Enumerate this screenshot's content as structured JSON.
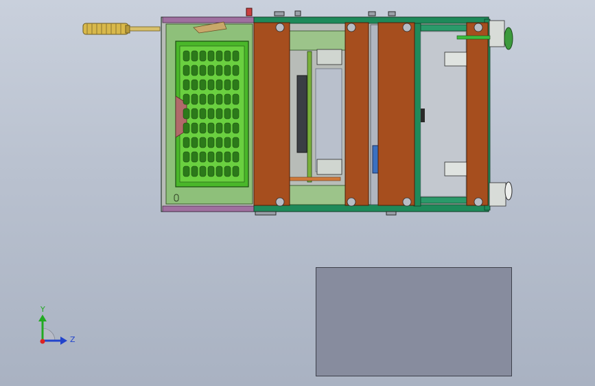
{
  "triad": {
    "y_label": "Y",
    "z_label": "Z"
  },
  "colors": {
    "background_top": "#c9d0dc",
    "frame_green": "#1e8a5a",
    "plate_brown": "#a64e1e",
    "panel_green": "#6aa03c",
    "mesh_green": "#3dbb22",
    "handle_gold": "#d8b84a",
    "rail_purple": "#a070a0",
    "preview_gray": "#878c9e"
  }
}
